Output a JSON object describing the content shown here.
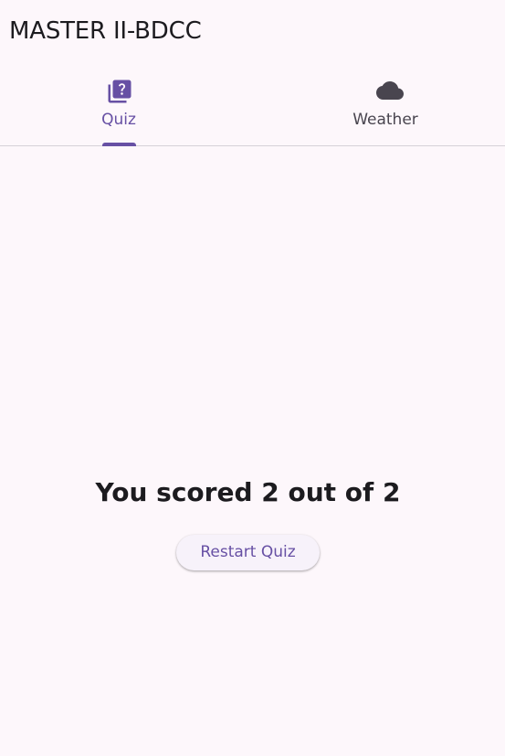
{
  "app": {
    "title": "MASTER II-BDCC"
  },
  "tabs": [
    {
      "label": "Quiz",
      "icon": "quiz-icon",
      "selected": true
    },
    {
      "label": "Weather",
      "icon": "cloud-icon",
      "selected": false
    }
  ],
  "quiz": {
    "score_text": "You scored 2 out of 2",
    "restart_label": "Restart Quiz"
  },
  "colors": {
    "accent": "#6750a4",
    "background": "#fdf7fb",
    "inactive": "#49454f"
  }
}
